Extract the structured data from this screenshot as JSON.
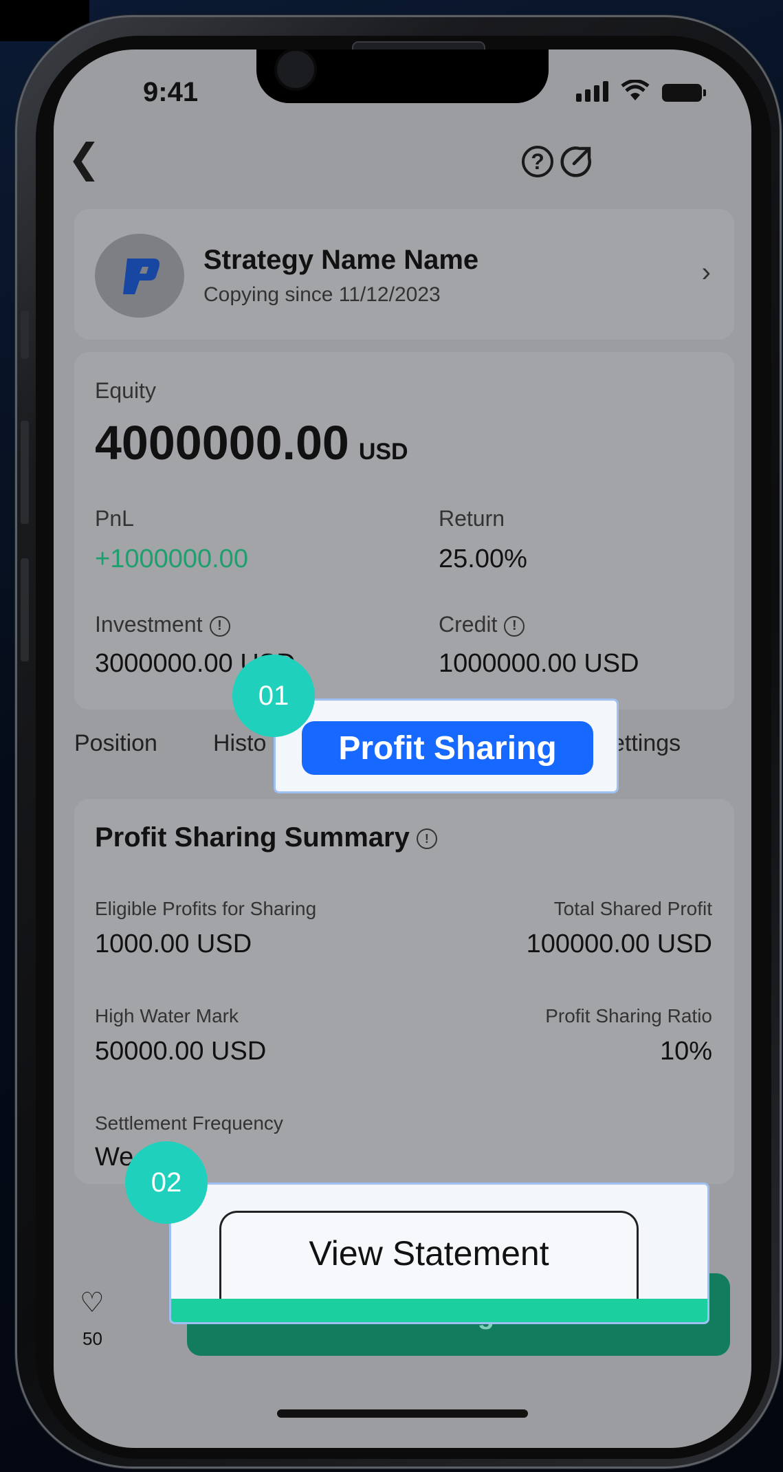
{
  "status_bar": {
    "time": "9:41"
  },
  "strategy": {
    "name": "Strategy Name Name",
    "subtitle": "Copying since 11/12/2023"
  },
  "equity": {
    "label": "Equity",
    "value": "4000000.00",
    "unit": "USD",
    "pnl_label": "PnL",
    "pnl_value": "+1000000.00",
    "return_label": "Return",
    "return_value": "25.00%",
    "investment_label": "Investment",
    "investment_value": "3000000.00 USD",
    "credit_label": "Credit",
    "credit_value": "1000000.00 USD"
  },
  "tabs": [
    "Position",
    "Histo",
    "ettings"
  ],
  "profit_sharing": {
    "title": "Profit Sharing Summary",
    "eligible_label": "Eligible Profits for Sharing",
    "eligible_value": "1000.00 USD",
    "total_label": "Total Shared Profit",
    "total_value": "100000.00 USD",
    "hwm_label": "High Water Mark",
    "hwm_value": "50000.00 USD",
    "ratio_label": "Profit Sharing Ratio",
    "ratio_value": "10%",
    "freq_label": "Settlement Frequency",
    "freq_value": "We"
  },
  "bottom": {
    "likes": "50",
    "manage_label": "Manage"
  },
  "callouts": {
    "one": {
      "badge": "01",
      "label": "Profit Sharing"
    },
    "two": {
      "badge": "02",
      "label": "View Statement"
    }
  },
  "colors": {
    "pnl_green": "#1f9e6e",
    "manage_green": "#137c5f",
    "accent_blue": "#1668ff",
    "badge_teal": "#1fd1bd"
  }
}
